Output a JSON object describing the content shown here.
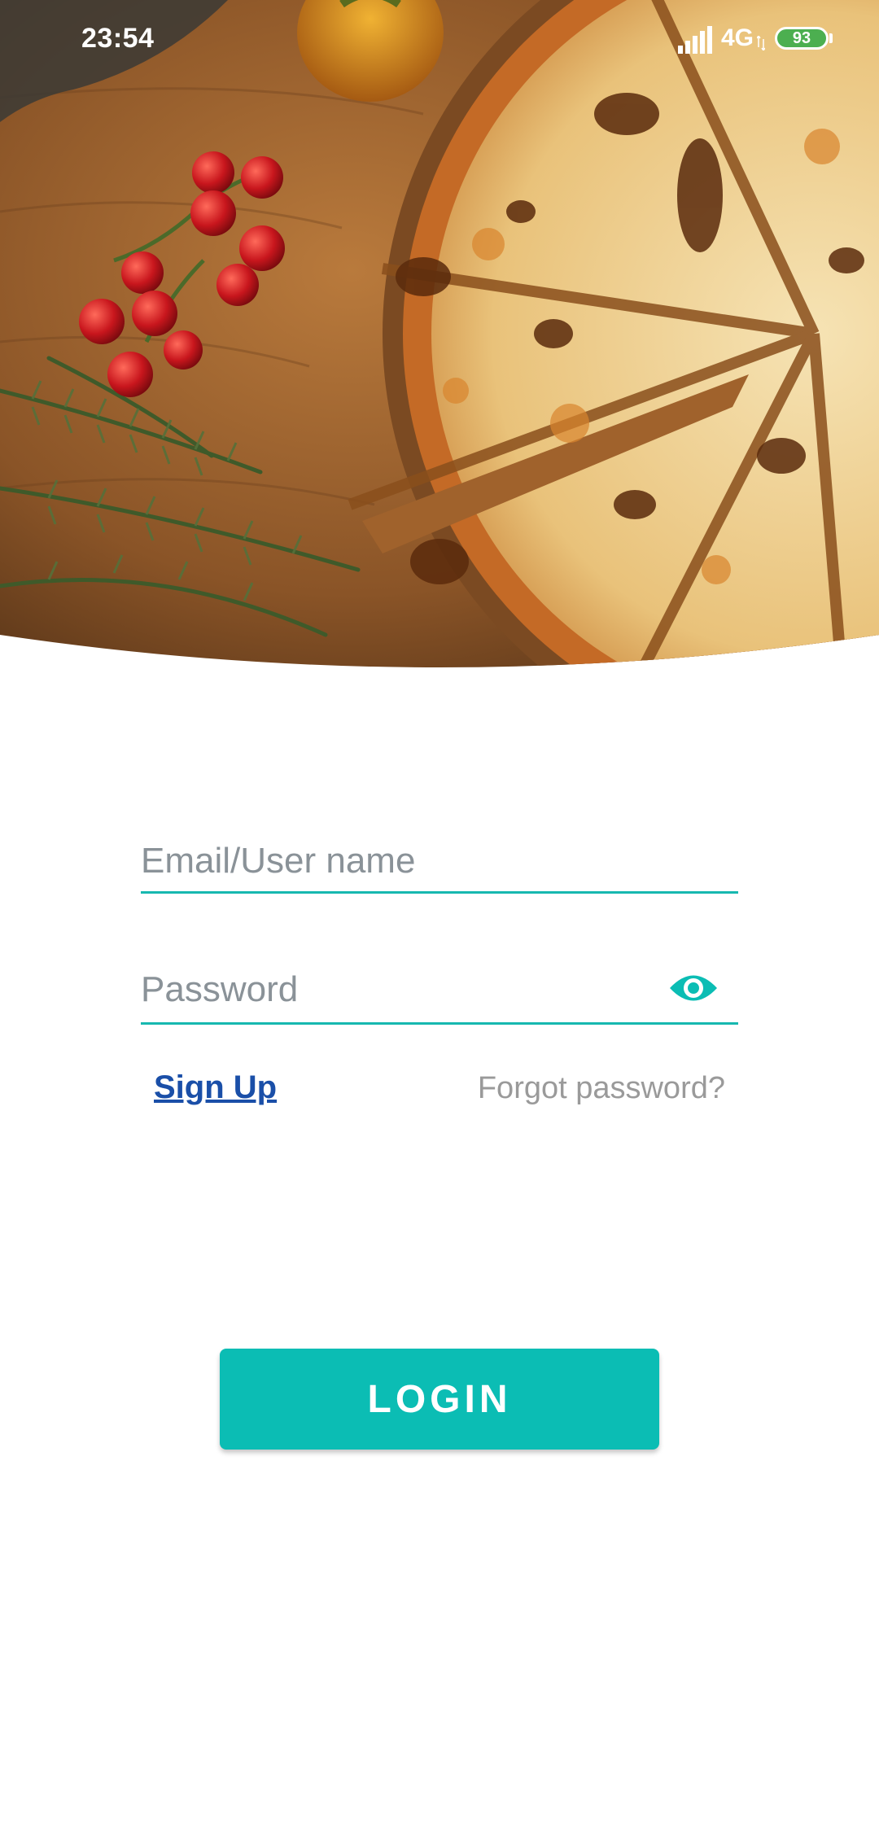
{
  "status_bar": {
    "time": "23:54",
    "network": "4G",
    "battery_level": "93"
  },
  "login_form": {
    "email_placeholder": "Email/User name",
    "email_value": "",
    "password_placeholder": "Password",
    "password_value": "",
    "password_toggle_icon": "eye-icon",
    "signup_label": "Sign Up",
    "forgot_label": "Forgot password?",
    "login_label": "LOGIN"
  },
  "colors": {
    "accent": "#0bbdb4",
    "link": "#1a4fa8",
    "muted_text": "#9a9a9a",
    "battery": "#4caf50"
  }
}
